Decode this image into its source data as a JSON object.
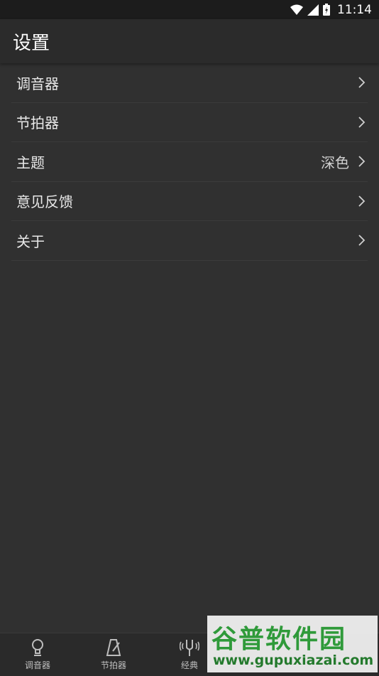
{
  "status_bar": {
    "time": "11:14"
  },
  "app_bar": {
    "title": "设置"
  },
  "settings": [
    {
      "label": "调音器",
      "value": ""
    },
    {
      "label": "节拍器",
      "value": ""
    },
    {
      "label": "主题",
      "value": "深色"
    },
    {
      "label": "意见反馈",
      "value": ""
    },
    {
      "label": "关于",
      "value": ""
    }
  ],
  "tabs": [
    {
      "label": "调音器",
      "icon": "tuner-icon"
    },
    {
      "label": "节拍器",
      "icon": "metronome-icon"
    },
    {
      "label": "经典",
      "icon": "tuning-fork-icon"
    }
  ],
  "watermark": {
    "title": "谷普软件园",
    "url": "www.gupuxiazai.com"
  },
  "colors": {
    "background": "#303030",
    "app_bar": "#2b2b2b",
    "status_bar": "#1c1c1c",
    "watermark_green": "#2f9a3a"
  }
}
